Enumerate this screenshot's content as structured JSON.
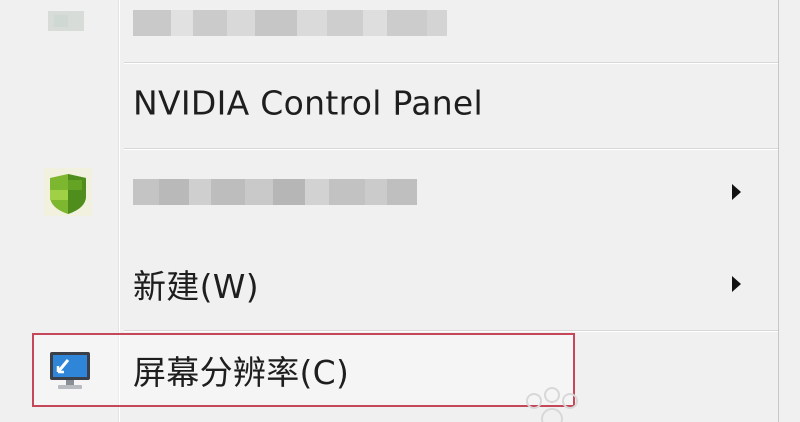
{
  "context_menu": {
    "items": [
      {
        "label": "",
        "obscured": true
      },
      {
        "label": "NVIDIA Control Panel"
      },
      {
        "label": "",
        "obscured": true,
        "has_submenu": true
      },
      {
        "label": "新建(W)",
        "has_submenu": true
      },
      {
        "label": "屏幕分辨率(C)",
        "highlighted": true
      }
    ]
  },
  "icons": {
    "top": "blurred-app-icon",
    "third": "green-shield-icon",
    "screen_resolution": "monitor-icon",
    "submenu": "chevron-right-icon"
  },
  "colors": {
    "menu_background": "#f0f0f0",
    "highlight_border": "#c4485a",
    "text": "#1e1e1e"
  }
}
